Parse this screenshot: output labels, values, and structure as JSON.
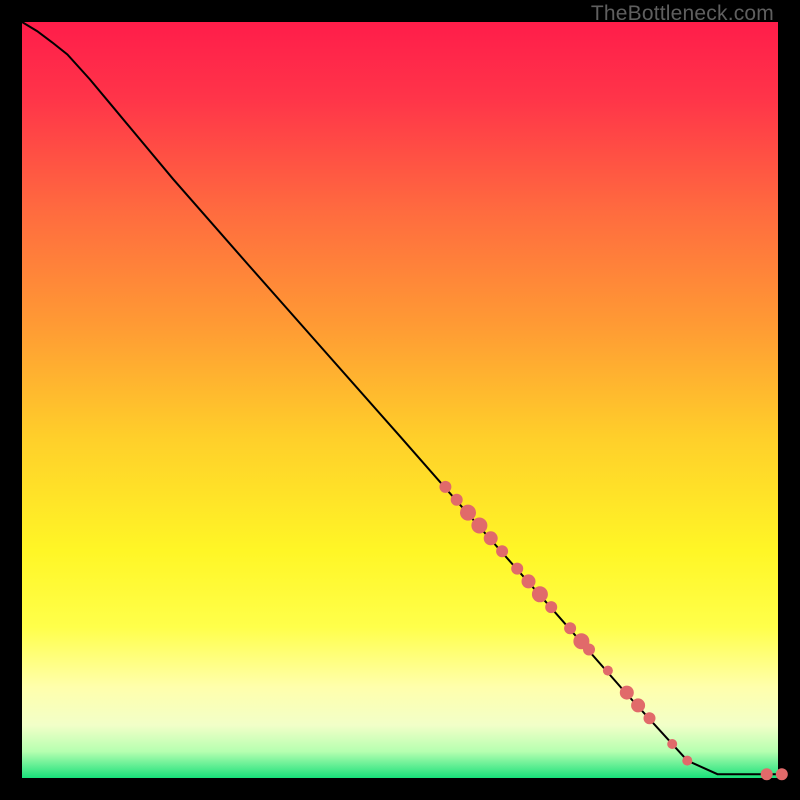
{
  "watermark": "TheBottleneck.com",
  "colors": {
    "point_fill": "#e16a6a",
    "point_stroke": "#c94f4f",
    "curve": "#000000",
    "green": "#18e07a"
  },
  "chart_data": {
    "type": "line",
    "title": "",
    "xlabel": "",
    "ylabel": "",
    "xlim": [
      0,
      100
    ],
    "ylim": [
      0,
      100
    ],
    "curve": [
      {
        "x": 0.0,
        "y": 100.0
      },
      {
        "x": 2.0,
        "y": 98.8
      },
      {
        "x": 4.0,
        "y": 97.3
      },
      {
        "x": 6.0,
        "y": 95.7
      },
      {
        "x": 9.0,
        "y": 92.4
      },
      {
        "x": 12.0,
        "y": 88.8
      },
      {
        "x": 16.0,
        "y": 84.0
      },
      {
        "x": 20.0,
        "y": 79.2
      },
      {
        "x": 30.0,
        "y": 67.8
      },
      {
        "x": 40.0,
        "y": 56.5
      },
      {
        "x": 50.0,
        "y": 45.2
      },
      {
        "x": 60.0,
        "y": 33.8
      },
      {
        "x": 70.0,
        "y": 22.5
      },
      {
        "x": 80.0,
        "y": 11.1
      },
      {
        "x": 88.0,
        "y": 2.3
      },
      {
        "x": 92.0,
        "y": 0.5
      },
      {
        "x": 95.0,
        "y": 0.5
      },
      {
        "x": 100.0,
        "y": 0.5
      }
    ],
    "points": [
      {
        "x": 56.0,
        "y": 38.5,
        "r": 6
      },
      {
        "x": 57.5,
        "y": 36.8,
        "r": 6
      },
      {
        "x": 59.0,
        "y": 35.1,
        "r": 8
      },
      {
        "x": 60.5,
        "y": 33.4,
        "r": 8
      },
      {
        "x": 62.0,
        "y": 31.7,
        "r": 7
      },
      {
        "x": 63.5,
        "y": 30.0,
        "r": 6
      },
      {
        "x": 65.5,
        "y": 27.7,
        "r": 6
      },
      {
        "x": 67.0,
        "y": 26.0,
        "r": 7
      },
      {
        "x": 68.5,
        "y": 24.3,
        "r": 8
      },
      {
        "x": 70.0,
        "y": 22.6,
        "r": 6
      },
      {
        "x": 72.5,
        "y": 19.8,
        "r": 6
      },
      {
        "x": 74.0,
        "y": 18.1,
        "r": 8
      },
      {
        "x": 75.0,
        "y": 17.0,
        "r": 6
      },
      {
        "x": 77.5,
        "y": 14.2,
        "r": 5
      },
      {
        "x": 80.0,
        "y": 11.3,
        "r": 7
      },
      {
        "x": 81.5,
        "y": 9.6,
        "r": 7
      },
      {
        "x": 83.0,
        "y": 7.9,
        "r": 6
      },
      {
        "x": 86.0,
        "y": 4.5,
        "r": 5
      },
      {
        "x": 88.0,
        "y": 2.3,
        "r": 5
      },
      {
        "x": 98.5,
        "y": 0.5,
        "r": 6
      },
      {
        "x": 100.5,
        "y": 0.5,
        "r": 6
      }
    ],
    "gradient_stops": [
      {
        "offset": 0.0,
        "color": "#ff1d4a"
      },
      {
        "offset": 0.1,
        "color": "#ff3449"
      },
      {
        "offset": 0.25,
        "color": "#ff6b3f"
      },
      {
        "offset": 0.4,
        "color": "#ff9a34"
      },
      {
        "offset": 0.55,
        "color": "#ffcf2a"
      },
      {
        "offset": 0.7,
        "color": "#fff626"
      },
      {
        "offset": 0.8,
        "color": "#ffff4a"
      },
      {
        "offset": 0.88,
        "color": "#ffffac"
      },
      {
        "offset": 0.93,
        "color": "#f2ffc8"
      },
      {
        "offset": 0.965,
        "color": "#b6ffb0"
      },
      {
        "offset": 1.0,
        "color": "#18e07a"
      }
    ]
  }
}
